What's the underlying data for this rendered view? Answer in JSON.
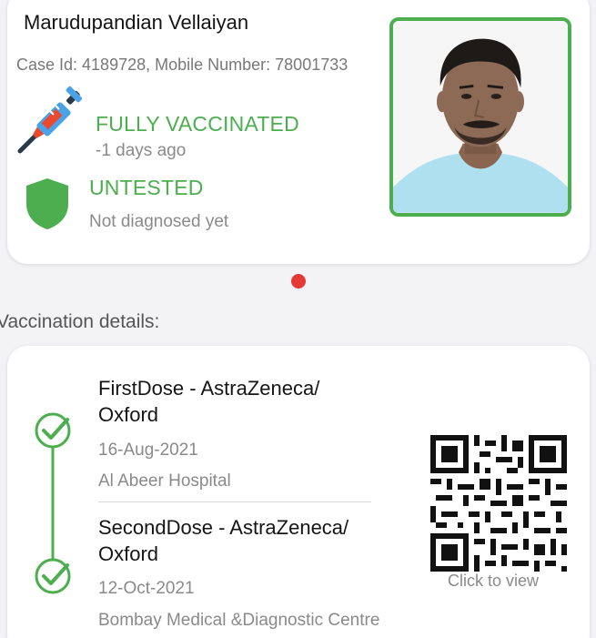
{
  "profile": {
    "name": "Marudupandian Vellaiyan",
    "case_line": "Case Id: 4189728, Mobile Number: 78001733",
    "photo_icon": "person-photo"
  },
  "vaccination_status": {
    "title": "FULLY VACCINATED",
    "subtitle": "-1 days ago",
    "icon": "syringe-icon"
  },
  "test_status": {
    "title": "UNTESTED",
    "subtitle": "Not diagnosed yet",
    "icon": "shield-icon"
  },
  "colors": {
    "accent_green": "#4cae4f",
    "page_indicator_red": "#e53935"
  },
  "details": {
    "section_title": "Vaccination details:",
    "doses": [
      {
        "title": "FirstDose - AstraZeneca/ Oxford",
        "date": "16-Aug-2021",
        "place": "Al Abeer Hospital"
      },
      {
        "title": "SecondDose - AstraZeneca/ Oxford",
        "date": "12-Oct-2021",
        "place": "Bombay Medical &Diagnostic Centre"
      }
    ],
    "qr_caption": "Click to view"
  }
}
